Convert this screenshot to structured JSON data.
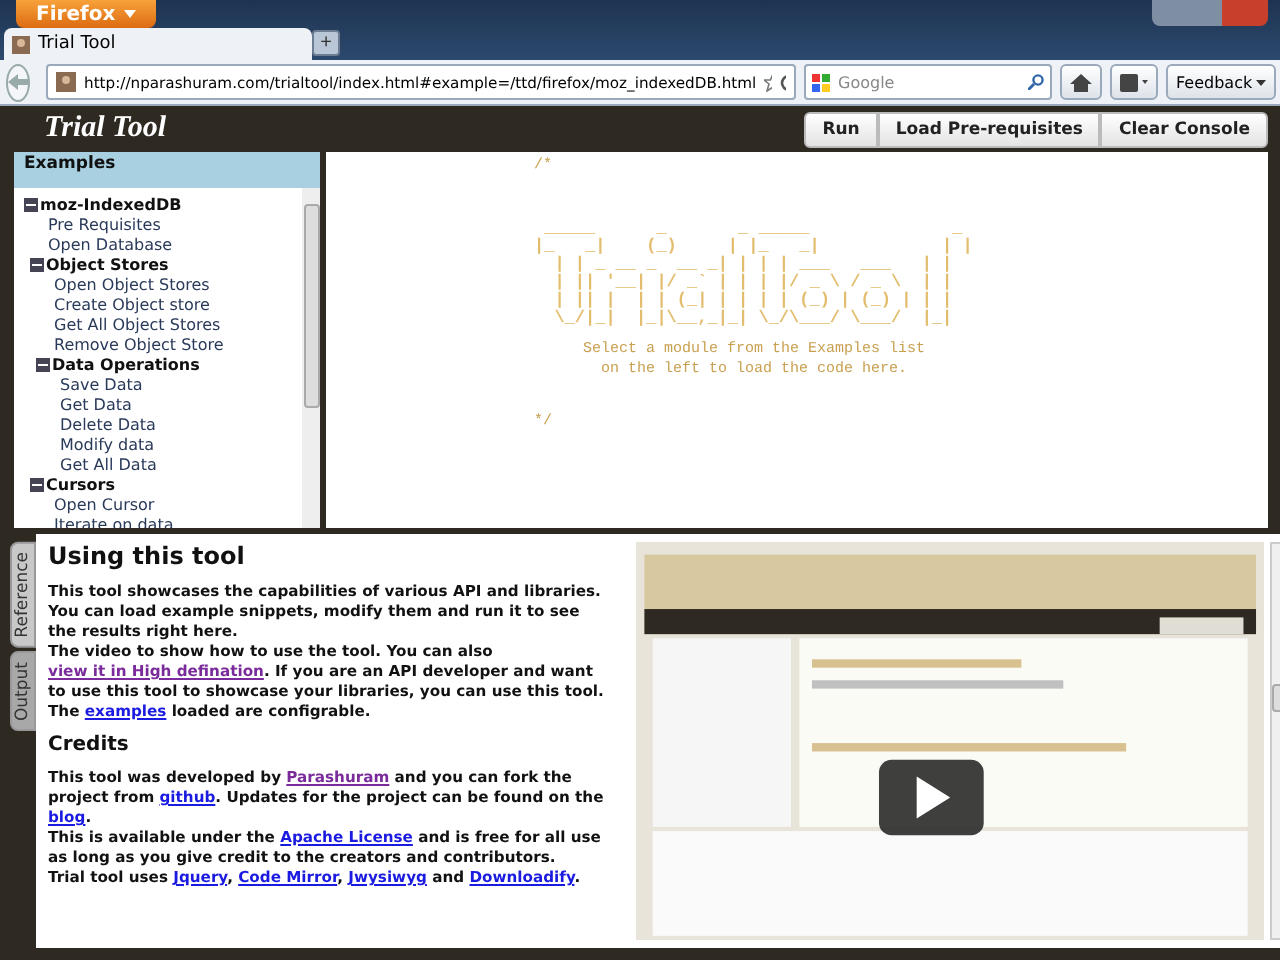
{
  "browser": {
    "menu_button": "Firefox",
    "tab_title": "Trial Tool",
    "new_tab": "+",
    "url": "http://nparashuram.com/trialtool/index.html#example=/ttd/firefox/moz_indexedDB.html",
    "search_placeholder": "Google",
    "feedback": "Feedback"
  },
  "app": {
    "title": "Trial Tool",
    "buttons": [
      "Run",
      "Load Pre-requisites",
      "Clear Console"
    ]
  },
  "sidebar": {
    "heading": "Examples",
    "tree": [
      {
        "label": "moz-IndexedDB",
        "expanded": true,
        "children": [
          {
            "label": "Pre Requisites"
          },
          {
            "label": "Open Database"
          },
          {
            "label": "Object Stores",
            "expanded": true,
            "children": [
              {
                "label": "Open Object Stores"
              },
              {
                "label": "Create Object store"
              },
              {
                "label": "Get All Object Stores"
              },
              {
                "label": "Remove Object Store"
              },
              {
                "label": "Data Operations",
                "expanded": true,
                "children": [
                  {
                    "label": "Save Data"
                  },
                  {
                    "label": "Get Data"
                  },
                  {
                    "label": "Delete Data"
                  },
                  {
                    "label": "Modify data"
                  },
                  {
                    "label": "Get All Data"
                  }
                ]
              }
            ]
          },
          {
            "label": "Cursors",
            "expanded": true,
            "children": [
              {
                "label": "Open Cursor"
              },
              {
                "label": "Iterate on data"
              }
            ]
          }
        ]
      }
    ]
  },
  "editor": {
    "comment_open": "/*",
    "ascii_art": [
      " _____      _       _ _____              _ ",
      "|_   _|    (_)     | |_   _|            | |",
      "  | | _ __ _  __ _| | | | ___   ___   | |",
      "  | || '__| |/ _` | | | |/ _ \\ / _ \\  | |",
      "  | || |  | | (_| | | | | (_) | (_) | | |",
      "  \\_/|_|  |_|\\__,_|_| \\_/\\___/ \\___/  |_|"
    ],
    "message": [
      "Select a module from the Examples list",
      "on the left to load the code here."
    ],
    "comment_close": "*/"
  },
  "side_tabs": [
    {
      "label": "Reference",
      "selected": true
    },
    {
      "label": "Output",
      "selected": false
    }
  ],
  "doc": {
    "heading": "Using this tool",
    "paragraphs": [
      [
        {
          "text": "This tool showcases the capabilities of various API and libraries. You can load example snippets, modify them and run it to see the results right here."
        }
      ],
      [
        {
          "text": "The video to show how to use the tool. You can also "
        },
        {
          "text": "view it in High defination",
          "link": true,
          "visited": true
        },
        {
          "text": ". If you are an API developer and want to use this tool to showcase your libraries, you can use this tool. The "
        },
        {
          "text": "examples",
          "link": true,
          "visited": false
        },
        {
          "text": " loaded are configrable."
        }
      ]
    ],
    "credits_heading": "Credits",
    "credits": [
      [
        {
          "text": "This tool was developed by "
        },
        {
          "text": "Parashuram",
          "link": true,
          "visited": true
        },
        {
          "text": " and you can fork the project from "
        },
        {
          "text": "github",
          "link": true,
          "visited": false
        },
        {
          "text": ". Updates for the project can be found on the "
        },
        {
          "text": "blog",
          "link": true,
          "visited": false
        },
        {
          "text": "."
        }
      ],
      [
        {
          "text": "This is available under the "
        },
        {
          "text": "Apache License",
          "link": true,
          "visited": false
        },
        {
          "text": " and is free for all use as long as you give credit to the creators and contributors."
        }
      ],
      [
        {
          "text": "Trial tool uses "
        },
        {
          "text": "Jquery",
          "link": true,
          "visited": false
        },
        {
          "text": ", "
        },
        {
          "text": "Code Mirror",
          "link": true,
          "visited": false
        },
        {
          "text": ", "
        },
        {
          "text": "Jwysiwyg",
          "link": true,
          "visited": false
        },
        {
          "text": " and "
        },
        {
          "text": "Downloadify",
          "link": true,
          "visited": false
        },
        {
          "text": "."
        }
      ]
    ]
  }
}
